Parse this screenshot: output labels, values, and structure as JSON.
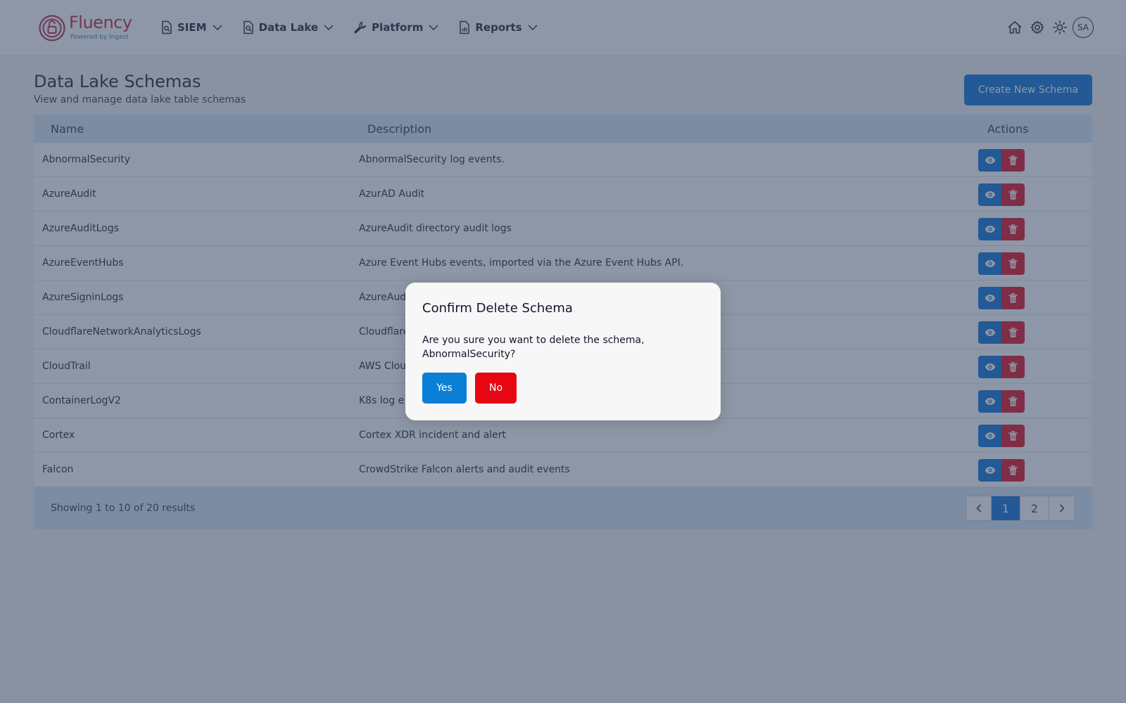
{
  "header": {
    "logo_text": "Fluency",
    "logo_subtext": "Powered by Ingest",
    "nav": [
      {
        "label": "SIEM",
        "icon": "search-document-icon"
      },
      {
        "label": "Data Lake",
        "icon": "search-document-icon"
      },
      {
        "label": "Platform",
        "icon": "wrench-icon"
      },
      {
        "label": "Reports",
        "icon": "report-document-icon"
      }
    ],
    "avatar_initials": "SA",
    "icons": [
      "home-icon",
      "gear-icon",
      "sun-icon"
    ]
  },
  "page": {
    "title": "Data Lake Schemas",
    "subtitle": "View and manage data lake table schemas",
    "create_button": "Create New Schema"
  },
  "table": {
    "columns": [
      "Name",
      "Description",
      "Actions"
    ],
    "rows": [
      {
        "name": "AbnormalSecurity",
        "description": "AbnormalSecurity log events."
      },
      {
        "name": "AzureAudit",
        "description": "AzurAD Audit"
      },
      {
        "name": "AzureAuditLogs",
        "description": "AzureAudit directory audit logs"
      },
      {
        "name": "AzureEventHubs",
        "description": "Azure Event Hubs events, imported via the Azure Event Hubs API."
      },
      {
        "name": "AzureSigninLogs",
        "description": "AzureAud"
      },
      {
        "name": "CloudflareNetworkAnalyticsLogs",
        "description": "Cloudflare"
      },
      {
        "name": "CloudTrail",
        "description": "AWS Clou"
      },
      {
        "name": "ContainerLogV2",
        "description": "K8s log e"
      },
      {
        "name": "Cortex",
        "description": "Cortex XDR incident and alert"
      },
      {
        "name": "Falcon",
        "description": "CrowdStrike Falcon alerts and audit events"
      }
    ],
    "results_text": "Showing 1 to 10 of 20 results",
    "pages": [
      "1",
      "2"
    ],
    "current_page": "1"
  },
  "modal": {
    "title": "Confirm Delete Schema",
    "message": "Are you sure you want to delete the schema, AbnormalSecurity?",
    "yes_label": "Yes",
    "no_label": "No"
  },
  "colors": {
    "primary": "#2683dc",
    "danger": "#e12c3c",
    "yes_button": "#0a7fd6",
    "no_button": "#e60712",
    "brand": "#c2415b"
  }
}
